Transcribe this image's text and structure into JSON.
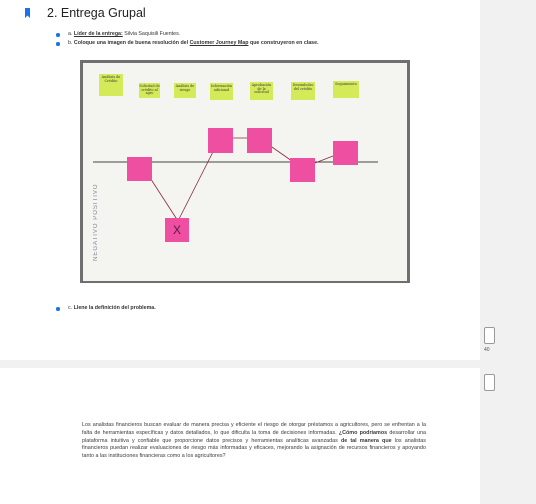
{
  "document": {
    "heading": "2. Entrega Grupal",
    "items": {
      "a_marker": "a.",
      "a_label": "Líder de la entrega:",
      "a_value": "Silvia Saquisili Fuentes.",
      "b_marker": "b.",
      "b_text_pre": "Coloque una imagen de buena resolución del",
      "b_link": "Customer Journey Map",
      "b_text_post": "que construyeron en clase.",
      "c_marker": "c.",
      "c_text": "Llene la definición del problema."
    },
    "photo": {
      "wall_text": "NEGATIVO   POSITIVO",
      "stickies": [
        "Análisis de Crédito",
        "Solicitud de crédito al agro",
        "Análisis de riesgo",
        "Información adicional",
        "Aprobación de la solicitud",
        "Desembolso del crédito",
        "Seguimiento"
      ],
      "x_mark": "X"
    },
    "paragraph": {
      "s1": "Los analistas financieros buscan evaluar de manera precisa y eficiente el riesgo de otorgar préstamos a agricultores, pero se enfrentan a la falta de herramientas específicas y datos detallados, lo que dificulta la toma de decisiones informadas.",
      "q": "¿Cómo podríamos",
      "s2": "desarrollar una plataforma intuitiva y confiable que proporcione datos precisos y herramientas analíticas avanzadas",
      "bold2": "de tal manera que",
      "s3": "los analistas financieros puedan realizar evaluaciones de riesgo más informadas y eficaces, mejorando la asignación de recursos financieros y apoyando tanto a las instituciones financieras como a los agricultores?"
    }
  },
  "rail": {
    "page_number": "40"
  },
  "colors": {
    "accent": "#1a73e8",
    "sticky_green": "#d4ea59",
    "sticky_pink": "#ef4fa1"
  },
  "icons": [
    "bookmark-icon",
    "bullet-icon",
    "checkbox-icon"
  ]
}
